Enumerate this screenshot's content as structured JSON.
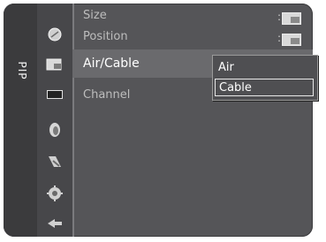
{
  "menu": {
    "vertical_tab": "PIP",
    "rows": [
      {
        "label": "Size",
        "colon": ":"
      },
      {
        "label": "Position",
        "colon": ":"
      },
      {
        "label": "Air/Cable",
        "colon": ":"
      },
      {
        "label": "Channel",
        "colon": ":"
      }
    ]
  },
  "dropdown": {
    "options": [
      "Air",
      "Cable"
    ],
    "selected": "Cable"
  },
  "icons": [
    "picture-icon",
    "sound-icon",
    "channel-icon",
    "setup-icon",
    "input-icon",
    "settings-icon",
    "return-icon"
  ]
}
